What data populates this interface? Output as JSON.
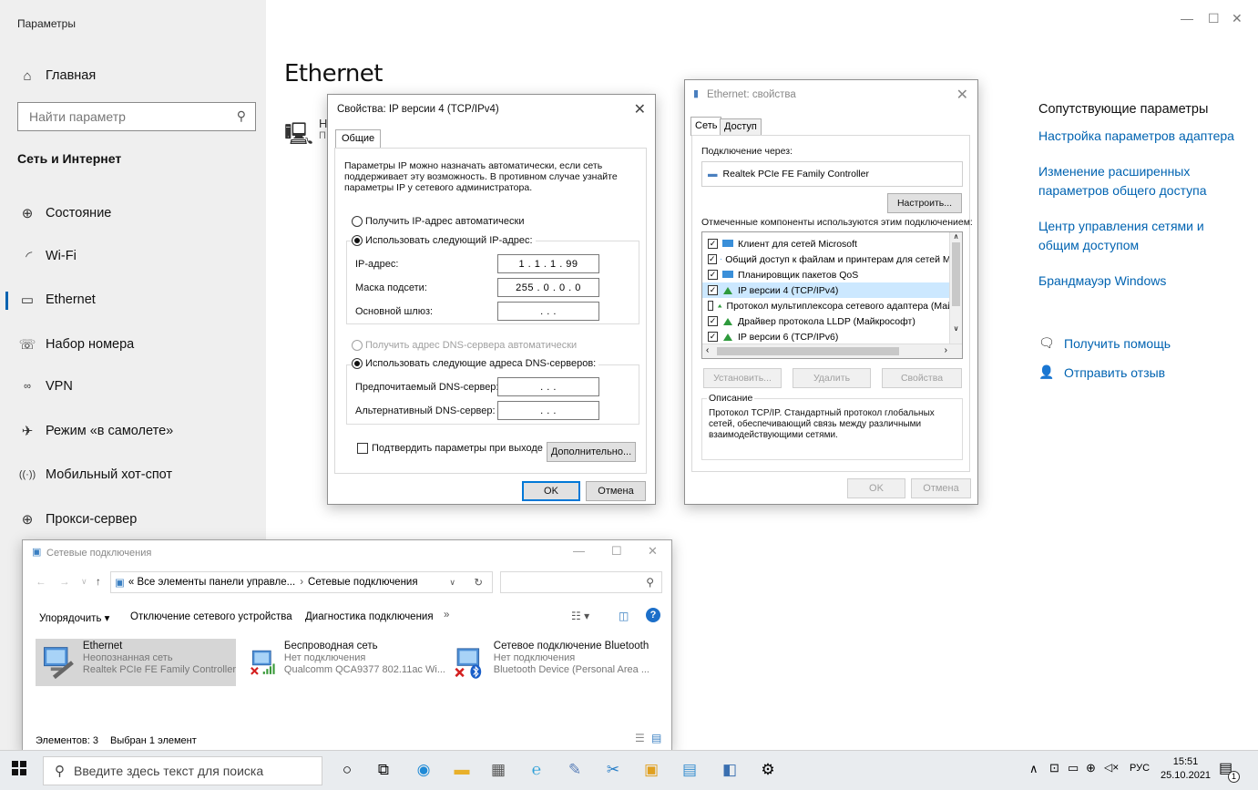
{
  "settings": {
    "app_title": "Параметры",
    "home": "Главная",
    "search_placeholder": "Найти параметр",
    "section": "Сеть и Интернет",
    "nav": [
      {
        "label": "Состояние",
        "icon": "globe-status-icon"
      },
      {
        "label": "Wi-Fi",
        "icon": "wifi-icon"
      },
      {
        "label": "Ethernet",
        "icon": "ethernet-icon"
      },
      {
        "label": "Набор номера",
        "icon": "dialup-icon"
      },
      {
        "label": "VPN",
        "icon": "vpn-icon"
      },
      {
        "label": "Режим «в самолете»",
        "icon": "airplane-icon"
      },
      {
        "label": "Мобильный хот-спот",
        "icon": "hotspot-icon"
      },
      {
        "label": "Прокси-сервер",
        "icon": "proxy-globe-icon"
      }
    ],
    "page_title": "Ethernet",
    "eth_letter_1": "Н",
    "eth_letter_2": "П",
    "related_title": "Сопутствующие параметры",
    "related_links": [
      "Настройка параметров адаптера",
      "Изменение расширенных параметров общего доступа",
      "Центр управления сетями и общим доступом",
      "Брандмауэр Windows"
    ],
    "help": "Получить помощь",
    "feedback": "Отправить отзыв",
    "accent": "#0063b1"
  },
  "ipv4_dialog": {
    "title": "Свойства: IP версии 4 (TCP/IPv4)",
    "tab": "Общие",
    "description": "Параметры IP можно назначать автоматически, если сеть поддерживает эту возможность. В противном случае узнайте параметры IP у сетевого администратора.",
    "auto_ip": "Получить IP-адрес автоматически",
    "manual_ip": "Использовать следующий IP-адрес:",
    "ip_label": "IP-адрес:",
    "ip_value": "1 . 1 . 1 . 99",
    "mask_label": "Маска подсети:",
    "mask_value": "255 . 0 . 0 . 0",
    "gateway_label": "Основной шлюз:",
    "gateway_value": ". . .",
    "auto_dns": "Получить адрес DNS-сервера автоматически",
    "manual_dns": "Использовать следующие адреса DNS-серверов:",
    "dns1_label": "Предпочитаемый DNS-сервер:",
    "dns1_value": ". . .",
    "dns2_label": "Альтернативный DNS-сервер:",
    "dns2_value": ". . .",
    "validate": "Подтвердить параметры при выходе",
    "advanced": "Дополнительно...",
    "ok": "OK",
    "cancel": "Отмена"
  },
  "eth_props": {
    "title": "Ethernet: свойства",
    "tab_net": "Сеть",
    "tab_access": "Доступ",
    "connect_via": "Подключение через:",
    "adapter": "Realtek PCIe FE Family Controller",
    "configure": "Настроить...",
    "components_label": "Отмеченные компоненты используются этим подключением:",
    "components": [
      {
        "label": "Клиент для сетей Microsoft",
        "checked": true
      },
      {
        "label": "Общий доступ к файлам и принтерам для сетей Mi",
        "checked": true
      },
      {
        "label": "Планировщик пакетов QoS",
        "checked": true
      },
      {
        "label": "IP версии 4 (TCP/IPv4)",
        "checked": true
      },
      {
        "label": "Протокол мультиплексора сетевого адаптера (Май",
        "checked": false
      },
      {
        "label": "Драйвер протокола LLDP (Майкрософт)",
        "checked": true
      },
      {
        "label": "IP версии 6 (TCP/IPv6)",
        "checked": true
      }
    ],
    "install": "Установить...",
    "remove": "Удалить",
    "properties": "Свойства",
    "desc_title": "Описание",
    "desc_text": "Протокол TCP/IP. Стандартный протокол глобальных сетей, обеспечивающий связь между различными взаимодействующими сетями.",
    "ok": "OK",
    "cancel": "Отмена"
  },
  "netconn": {
    "title": "Сетевые подключения",
    "breadcrumb_root": "« Все элементы панели управле...",
    "breadcrumb_current": "Сетевые подключения",
    "organize": "Упорядочить",
    "disable": "Отключение сетевого устройства",
    "diagnose": "Диагностика подключения",
    "more": "»",
    "connections": [
      {
        "name": "Ethernet",
        "status": "Неопознанная сеть",
        "device": "Realtek PCIe FE Family Controller"
      },
      {
        "name": "Беспроводная сеть",
        "status": "Нет подключения",
        "device": "Qualcomm QCA9377 802.11ac Wi..."
      },
      {
        "name": "Сетевое подключение Bluetooth",
        "status": "Нет подключения",
        "device": "Bluetooth Device (Personal Area ..."
      }
    ],
    "items_count": "Элементов: 3",
    "selected": "Выбран 1 элемент"
  },
  "taskbar": {
    "search_placeholder": "Введите здесь текст для поиска",
    "lang": "РУС",
    "time": "15:51",
    "date": "25.10.2021",
    "notif_count": "1"
  }
}
